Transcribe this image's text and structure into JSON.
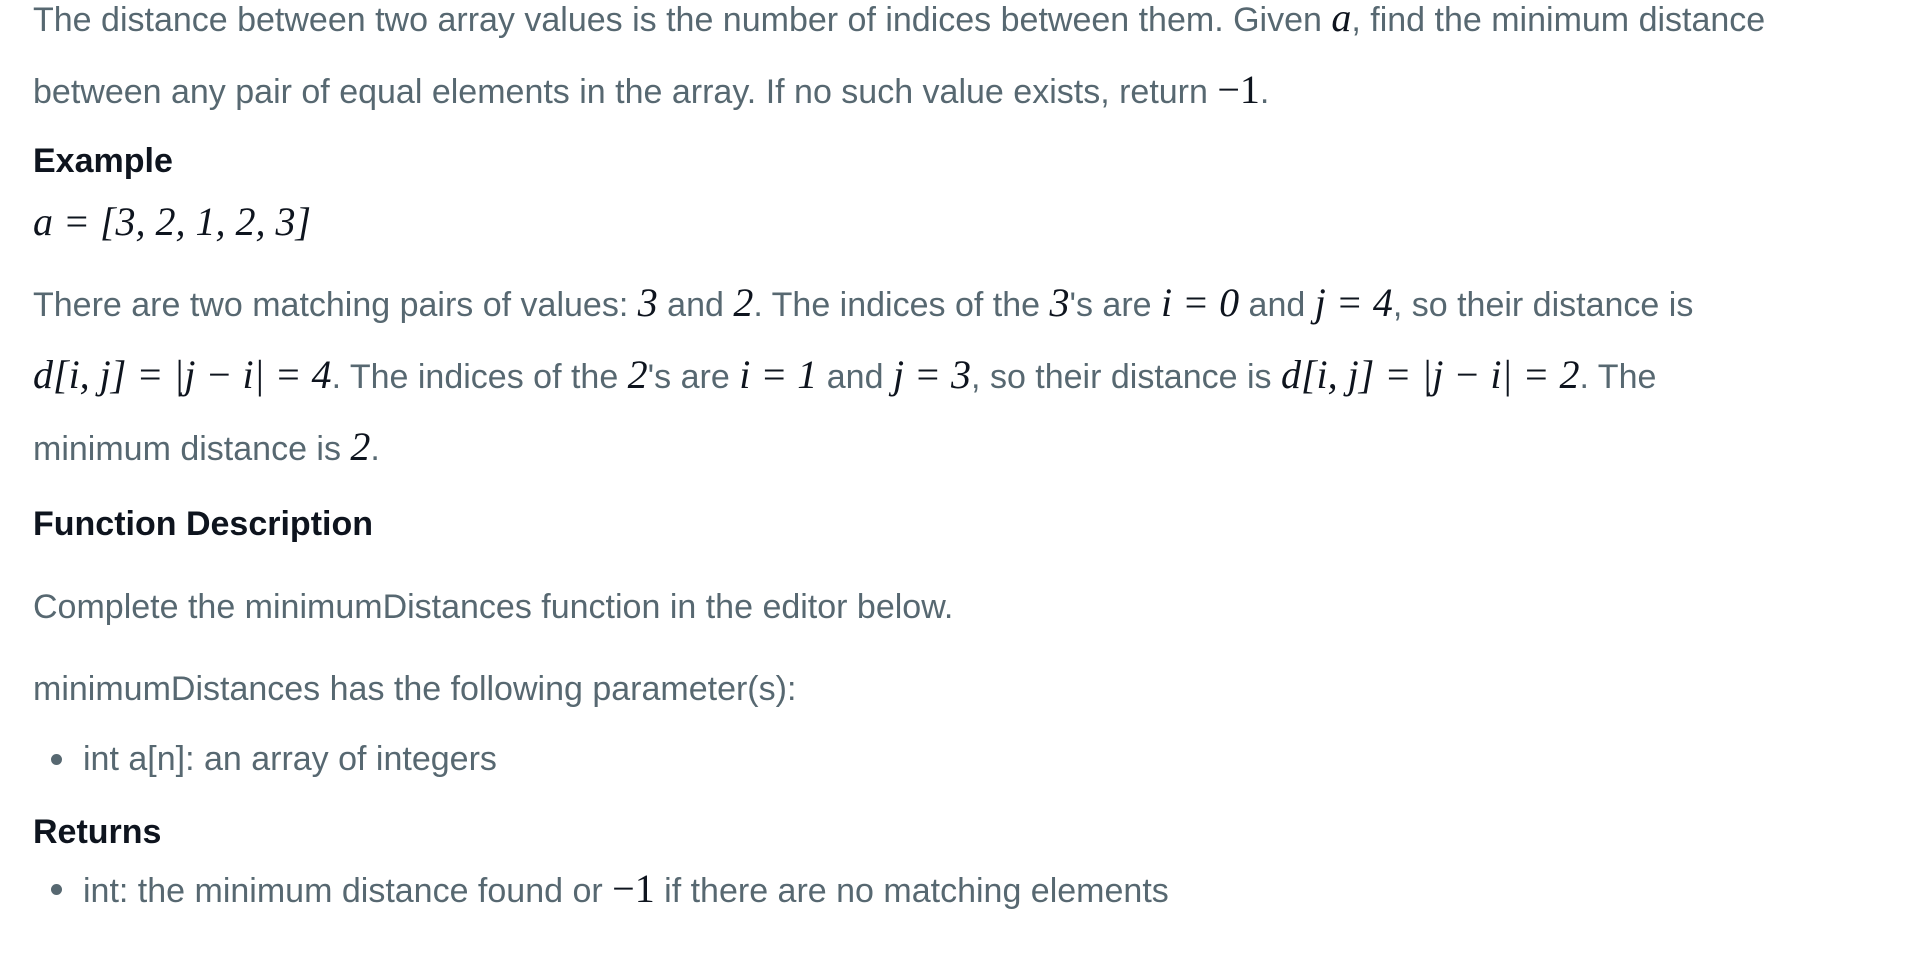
{
  "intro": {
    "line1_a": "The distance between two array values is the number of indices between them. Given ",
    "line1_var": "a",
    "line1_b": ", find the minimum distance",
    "line2_a": "between any pair of equal elements in the array. If no such value exists, return ",
    "line2_math": "−1",
    "line2_b": "."
  },
  "example": {
    "heading": "Example",
    "array_line": "a = [3, 2, 1, 2, 3]",
    "line1": [
      {
        "t": "text",
        "v": "There are two matching pairs of values: "
      },
      {
        "t": "math",
        "v": "3"
      },
      {
        "t": "text",
        "v": " and "
      },
      {
        "t": "math",
        "v": "2"
      },
      {
        "t": "text",
        "v": ". The indices of the "
      },
      {
        "t": "math",
        "v": "3"
      },
      {
        "t": "text",
        "v": "'s are "
      },
      {
        "t": "math",
        "v": "i = 0"
      },
      {
        "t": "text",
        "v": " and "
      },
      {
        "t": "math",
        "v": "j = 4"
      },
      {
        "t": "text",
        "v": ", so their distance is"
      }
    ],
    "line2": [
      {
        "t": "math",
        "v": "d[i, j] = |j − i| = 4"
      },
      {
        "t": "text",
        "v": ". The indices of the "
      },
      {
        "t": "math",
        "v": "2"
      },
      {
        "t": "text",
        "v": "'s are "
      },
      {
        "t": "math",
        "v": "i = 1"
      },
      {
        "t": "text",
        "v": " and "
      },
      {
        "t": "math",
        "v": "j = 3"
      },
      {
        "t": "text",
        "v": ", so their distance is "
      },
      {
        "t": "math",
        "v": "d[i, j] = |j − i| = 2"
      },
      {
        "t": "text",
        "v": ". The"
      }
    ],
    "line3": [
      {
        "t": "text",
        "v": "minimum distance is "
      },
      {
        "t": "math",
        "v": "2"
      },
      {
        "t": "text",
        "v": "."
      }
    ]
  },
  "function_description": {
    "heading": "Function Description",
    "line1": "Complete the minimumDistances function in the editor below.",
    "line2": "minimumDistances has the following parameter(s):",
    "params": [
      "int a[n]: an array of integers"
    ]
  },
  "returns": {
    "heading": "Returns",
    "item_a": "int: the minimum distance found or ",
    "item_math": "−1",
    "item_b": " if there are no matching elements"
  }
}
